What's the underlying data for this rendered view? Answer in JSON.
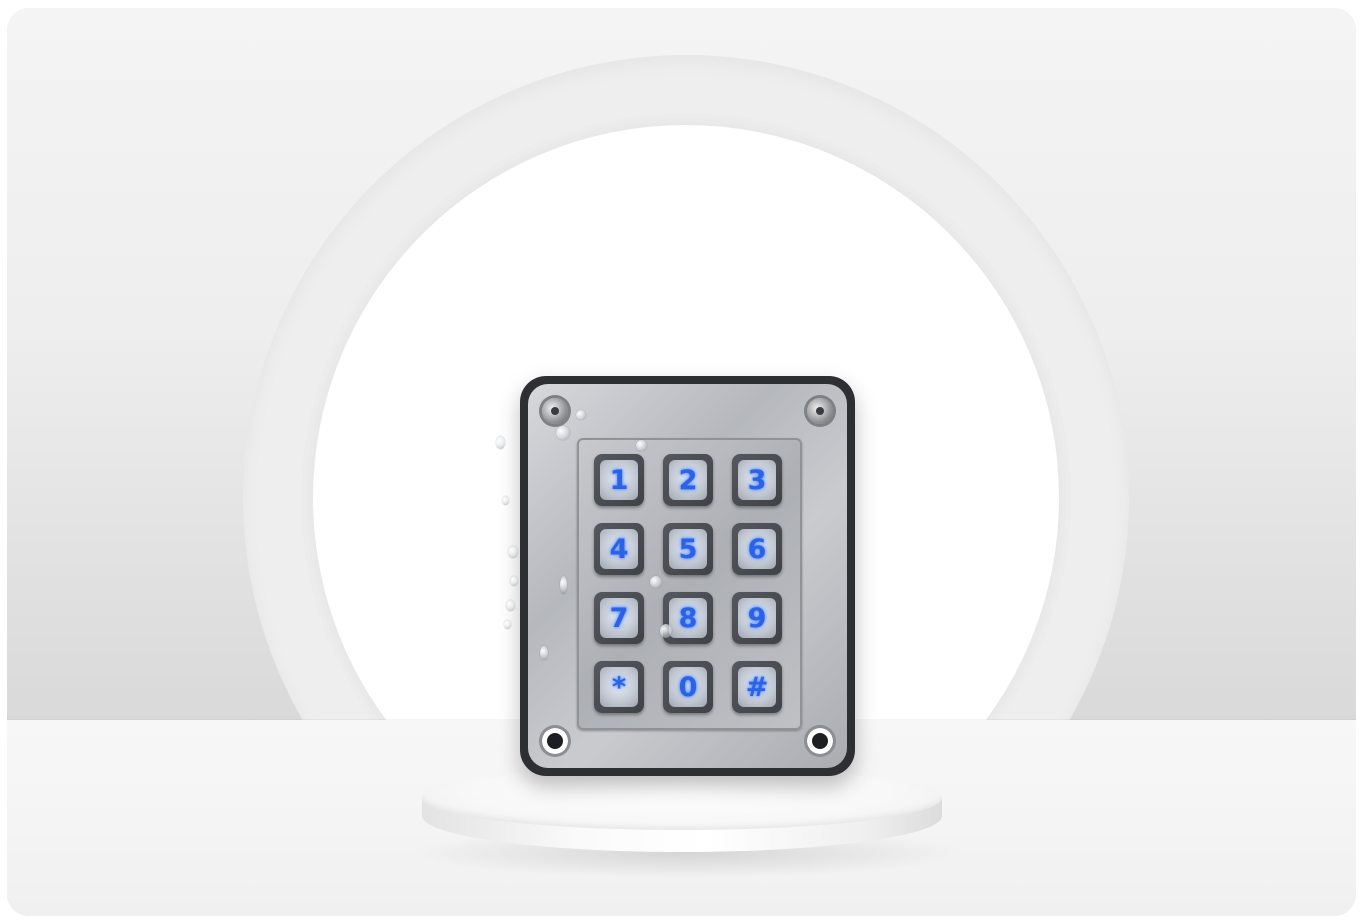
{
  "scene": {
    "subject": "keypad-icon",
    "colors": {
      "background": "#f0f0f0",
      "keypad_frame": "#2e2f33",
      "plate": "#c3c5c9",
      "key_glow": "#2c63e6"
    }
  },
  "keypad": {
    "keys": [
      "1",
      "2",
      "3",
      "4",
      "5",
      "6",
      "7",
      "8",
      "9",
      "*",
      "0",
      "#"
    ]
  }
}
